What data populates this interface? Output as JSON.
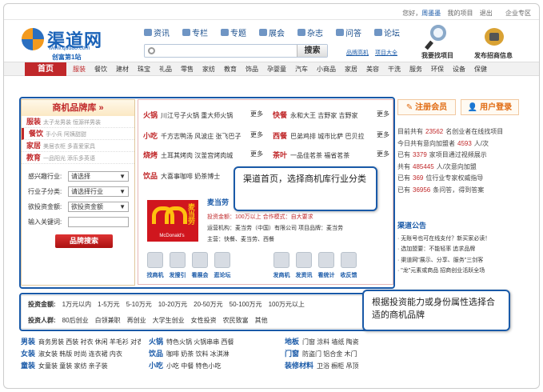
{
  "topbar": {
    "greeting": "您好，",
    "user": "周墨墨",
    "my_projects": "我的项目",
    "logout": "退出",
    "enterprise": "企业专区"
  },
  "logo": {
    "name": "渠道网",
    "domain": "www.qudao.com",
    "slogan": "创富第1站"
  },
  "nav": [
    "资讯",
    "专栏",
    "专题",
    "展会",
    "杂志",
    "问答",
    "论坛"
  ],
  "search": {
    "button": "搜索",
    "links": [
      "品牌高机",
      "项目大全"
    ]
  },
  "header_icons": {
    "find": "我要找项目",
    "publish": "发布招商信息"
  },
  "catbar": {
    "home": "首页",
    "cats": [
      "服装",
      "餐饮",
      "建材",
      "珠宝",
      "礼品",
      "零售",
      "家纺",
      "教育",
      "饰品",
      "孕婴童",
      "汽车",
      "小商品",
      "家居",
      "美容",
      "干洗",
      "服务",
      "环保",
      "设备",
      "保健"
    ]
  },
  "brand_panel": {
    "title": "商机品牌库 »",
    "rows": [
      {
        "cat": "服装",
        "desc": "太子龙男装  恒源祥男装"
      },
      {
        "cat": "餐饮",
        "desc": "手小兵  阿姨甜甜"
      },
      {
        "cat": "家居",
        "desc": "美居衣柜  多喜爱家具"
      },
      {
        "cat": "教育",
        "desc": "一品阳光  添乐多英语"
      }
    ],
    "filters": [
      {
        "label": "感兴趣行业:",
        "value": "请选择"
      },
      {
        "label": "行业子分类:",
        "value": "请选择行业"
      },
      {
        "label": "欲投资金额:",
        "value": "欲投资金额"
      }
    ],
    "keyword_label": "输入关键词:",
    "search_button": "品牌搜索"
  },
  "mid_panel": {
    "lines_left": [
      {
        "cat": "火锅",
        "items": "川江号子火锅  重大师火锅",
        "more": "更多"
      },
      {
        "cat": "小吃",
        "items": "千方志鸭汤  风波庄  张飞巴子",
        "more": "更多"
      },
      {
        "cat": "烧烤",
        "items": "土耳其烤肉  汉釜宫烤肉城",
        "more": "更多"
      },
      {
        "cat": "饮品",
        "items": "大喜事咖啡  奶茶博士",
        "more": ""
      }
    ],
    "lines_right": [
      {
        "cat": "快餐",
        "items": "永和大王  吉野家  吉野家",
        "more": "更多"
      },
      {
        "cat": "西餐",
        "items": "巴弟鸡排  城市比萨  巴贝拉",
        "more": "更多"
      },
      {
        "cat": "茶叶",
        "items": "一品佳茗茶  福省茗茶",
        "more": "更多"
      }
    ],
    "featured": {
      "logo_text": "McDonald's",
      "logo_cn": "麦当劳",
      "name": "麦当劳",
      "invest": "投资金额：100万以上  合作模式：自大要求",
      "company": "运营机构：麦当劳（中国）有限公司  项目品牌：麦当劳",
      "hot": "主营：快餐、麦当劳、西餐"
    },
    "tools_left": [
      "找商机",
      "发搜引",
      "看展会",
      "逛论坛"
    ],
    "tools_right": [
      "发商机",
      "发资讯",
      "看统计",
      "收反馈"
    ]
  },
  "invest": {
    "amount_label": "投资金额:",
    "amounts": [
      "1万元以内",
      "1-5万元",
      "5-10万元",
      "10-20万元",
      "20-50万元",
      "50-100万元",
      "100万元以上"
    ],
    "people_label": "投资人群:",
    "people": [
      "80后创业",
      "白领兼职",
      "再创业",
      "大学生创业",
      "女性投资",
      "农民致富",
      "其他"
    ]
  },
  "right_panel": {
    "register": "注册会员",
    "login": "用户登录",
    "stats": [
      {
        "pre": "目前共有",
        "num": "23562",
        "post": "名创业者在线找项目"
      },
      {
        "pre": "今日共有意向加盟者",
        "num": "4593",
        "post": "人/次"
      },
      {
        "pre": "已有",
        "num": "3379",
        "post": "家项目通过视频展示"
      },
      {
        "pre": "共有",
        "num": "485445",
        "post": "人/次意向加盟"
      },
      {
        "pre": "已有",
        "num": "369",
        "post": "位行业专家权威指导"
      },
      {
        "pre": "已有",
        "num": "36956",
        "post": "条问答，得到答案"
      }
    ]
  },
  "notice": {
    "title": "渠道公告",
    "items": [
      "无账号也可在线支付？新买家必读！",
      "选加盟要：不能轻率  追求品牌",
      "渠道网\"展示、分享、服务\"三剑客",
      "\"龙\"元素或商品  招商创业活跃全场"
    ]
  },
  "lower_rows": [
    {
      "cat": "男装",
      "items": "商务男装  西装  衬衣  休闲  羊毛衫  对衣",
      "cat2": "火锅",
      "items2": "特色火锅  火锅串串  西餐",
      "cat3": "地板",
      "items3": "门窗  涂料  墙纸  陶瓷"
    },
    {
      "cat": "女装",
      "items": "淑女装  韩版  时尚  连衣裙  内衣",
      "cat2": "饮品",
      "items2": "咖啡  奶茶  饮料  冰淇淋",
      "cat3": "门窗",
      "items3": "防盗门  铝合金  木门"
    },
    {
      "cat": "童装",
      "items": "女童装  童装  家纺  亲子装",
      "cat2": "小吃",
      "items2": "小吃  中餐  特色小吃",
      "cat3": "装修材料",
      "items3": "卫浴  橱柜  吊顶"
    }
  ],
  "callouts": {
    "one": "渠道首页，选择商机库行业分类",
    "two": "根据投资能力或身份属性选择合适的商机品牌"
  }
}
